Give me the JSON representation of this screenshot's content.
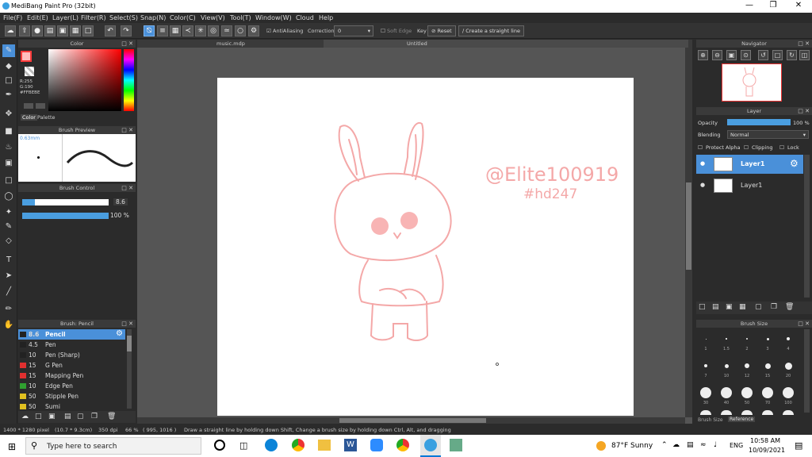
{
  "window": {
    "title": "MediBang Paint Pro (32bit)"
  },
  "menu": [
    "File(F)",
    "Edit(E)",
    "Layer(L)",
    "Filter(R)",
    "Select(S)",
    "Snap(N)",
    "Color(C)",
    "View(V)",
    "Tool(T)",
    "Window(W)",
    "Cloud",
    "Help"
  ],
  "toolbar": {
    "antialiasing": "AntiAliasing",
    "correction_label": "Correction",
    "correction_value": "0",
    "soft_edge": "Soft Edge",
    "key": "Key",
    "reset": "Reset",
    "straight_line": "Create a straight line"
  },
  "color_panel": {
    "title": "Color",
    "r": "R:255",
    "g": "G:190",
    "hex": "#FFBEBE",
    "tab_color": "Color",
    "tab_palette": "Palette",
    "accent": "#ff3b3b"
  },
  "brush_preview": {
    "title": "Brush Preview",
    "size": "0.63mm"
  },
  "brush_control": {
    "title": "Brush Control",
    "size_value": "8.6",
    "opacity_value": "100 %"
  },
  "brush_list": {
    "title": "Brush: Pencil",
    "items": [
      {
        "size": "8.6",
        "name": "Pencil",
        "color": "#222222",
        "selected": true
      },
      {
        "size": "4.5",
        "name": "Pen",
        "color": "#222222"
      },
      {
        "size": "10",
        "name": "Pen (Sharp)",
        "color": "#222222"
      },
      {
        "size": "15",
        "name": "G Pen",
        "color": "#e03030"
      },
      {
        "size": "15",
        "name": "Mapping Pen",
        "color": "#e03030"
      },
      {
        "size": "10",
        "name": "Edge Pen",
        "color": "#30a030"
      },
      {
        "size": "50",
        "name": "Stipple Pen",
        "color": "#e0c020"
      },
      {
        "size": "50",
        "name": "Sumi",
        "color": "#e0c020"
      }
    ]
  },
  "tabs": {
    "tab1": "music.mdp",
    "tab2": "Untitled"
  },
  "canvas": {
    "watermark_line1": "@Elite100919",
    "watermark_line2": "#hd247"
  },
  "navigator": {
    "title": "Navigator"
  },
  "layer_panel": {
    "title": "Layer",
    "opacity_label": "Opacity",
    "opacity_value": "100 %",
    "blending_label": "Blending",
    "blending_value": "Normal",
    "protect_alpha": "Protect Alpha",
    "clipping": "Clipping",
    "lock": "Lock",
    "layers": [
      "Layer1",
      "Layer1"
    ]
  },
  "brush_size": {
    "title": "Brush Size",
    "labels_row1": [
      "1",
      "1.5",
      "2",
      "3",
      "4"
    ],
    "labels_row2": [
      "7",
      "10",
      "12",
      "15",
      "20"
    ],
    "labels_row3": [
      "30",
      "40",
      "50",
      "70",
      "100"
    ],
    "tab_brush_size": "Brush Size",
    "tab_reference": "Reference"
  },
  "status": {
    "dims": "1400 * 1280 pixel",
    "cm": "(10.7 * 9.3cm)",
    "dpi": "350 dpi",
    "zoom": "66 %",
    "coords": "( 995, 1016 )",
    "hint": "Draw a straight line by holding down Shift, Change a brush size by holding down Ctrl, Alt, and dragging"
  },
  "taskbar": {
    "search": "Type here to search",
    "weather": "87°F Sunny",
    "lang": "ENG",
    "time": "10:58 AM",
    "date": "10/09/2021"
  }
}
